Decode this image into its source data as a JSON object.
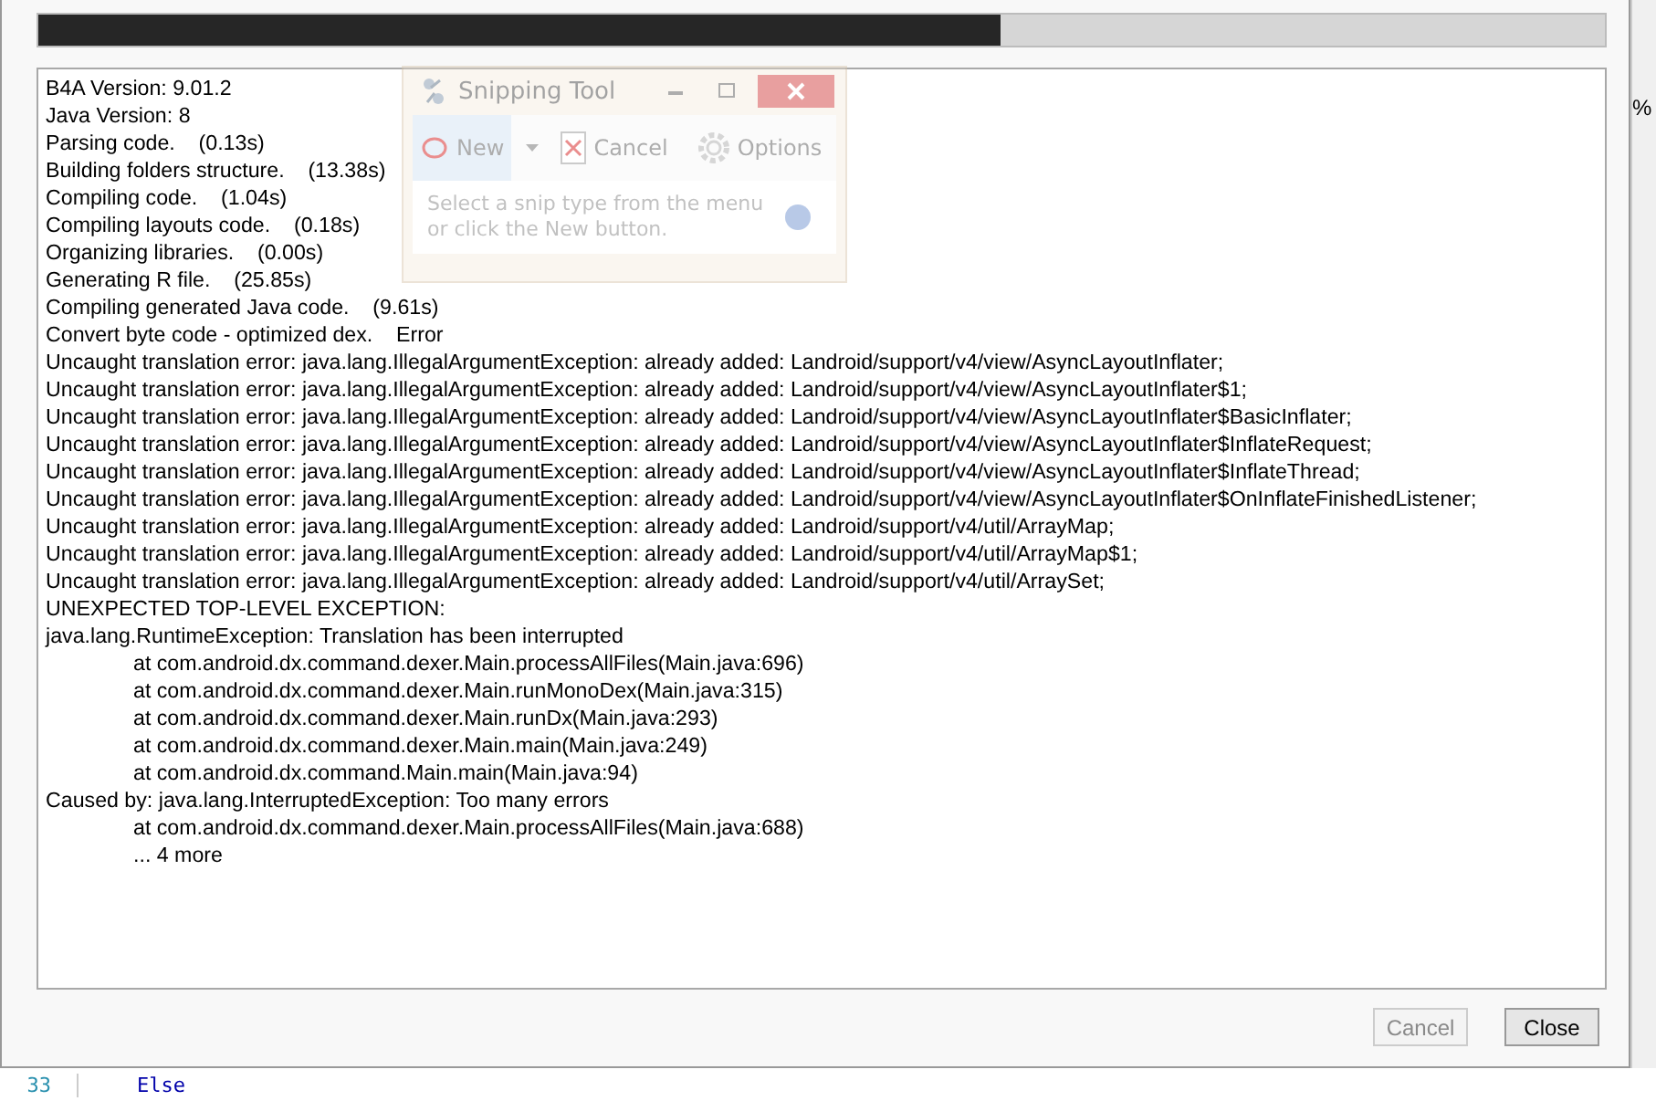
{
  "progress": {
    "level": 0.614
  },
  "log": [
    {
      "kind": "plain",
      "text": "B4A Version: 9.01.2"
    },
    {
      "kind": "plain",
      "text": "Java Version: 8"
    },
    {
      "kind": "plain",
      "text": "Parsing code.    (0.13s)"
    },
    {
      "kind": "plain",
      "text": "Building folders structure.    (13.38s)"
    },
    {
      "kind": "plain",
      "text": "Compiling code.    (1.04s)"
    },
    {
      "kind": "plain",
      "text": "Compiling layouts code.    (0.18s)"
    },
    {
      "kind": "plain",
      "text": "Organizing libraries.    (0.00s)"
    },
    {
      "kind": "plain",
      "text": "Generating R file.    (25.85s)"
    },
    {
      "kind": "plain",
      "text": "Compiling generated Java code.    (9.61s)"
    },
    {
      "kind": "plain",
      "text": "Convert byte code - optimized dex.    Error"
    },
    {
      "kind": "plain",
      "text": "Uncaught translation error: java.lang.IllegalArgumentException: already added: Landroid/support/v4/view/AsyncLayoutInflater;"
    },
    {
      "kind": "plain",
      "text": "Uncaught translation error: java.lang.IllegalArgumentException: already added: Landroid/support/v4/view/AsyncLayoutInflater$1;"
    },
    {
      "kind": "plain",
      "text": "Uncaught translation error: java.lang.IllegalArgumentException: already added: Landroid/support/v4/view/AsyncLayoutInflater$BasicInflater;"
    },
    {
      "kind": "plain",
      "text": "Uncaught translation error: java.lang.IllegalArgumentException: already added: Landroid/support/v4/view/AsyncLayoutInflater$InflateRequest;"
    },
    {
      "kind": "plain",
      "text": "Uncaught translation error: java.lang.IllegalArgumentException: already added: Landroid/support/v4/view/AsyncLayoutInflater$InflateThread;"
    },
    {
      "kind": "plain",
      "text": "Uncaught translation error: java.lang.IllegalArgumentException: already added: Landroid/support/v4/view/AsyncLayoutInflater$OnInflateFinishedListener;"
    },
    {
      "kind": "plain",
      "text": "Uncaught translation error: java.lang.IllegalArgumentException: already added: Landroid/support/v4/util/ArrayMap;"
    },
    {
      "kind": "plain",
      "text": "Uncaught translation error: java.lang.IllegalArgumentException: already added: Landroid/support/v4/util/ArrayMap$1;"
    },
    {
      "kind": "plain",
      "text": "Uncaught translation error: java.lang.IllegalArgumentException: already added: Landroid/support/v4/util/ArraySet;"
    },
    {
      "kind": "plain",
      "text": "UNEXPECTED TOP-LEVEL EXCEPTION:"
    },
    {
      "kind": "plain",
      "text": "java.lang.RuntimeException: Translation has been interrupted"
    },
    {
      "kind": "stack",
      "text": "at com.android.dx.command.dexer.Main.processAllFiles(Main.java:696)"
    },
    {
      "kind": "stack",
      "text": "at com.android.dx.command.dexer.Main.runMonoDex(Main.java:315)"
    },
    {
      "kind": "stack",
      "text": "at com.android.dx.command.dexer.Main.runDx(Main.java:293)"
    },
    {
      "kind": "stack",
      "text": "at com.android.dx.command.dexer.Main.main(Main.java:249)"
    },
    {
      "kind": "stack",
      "text": "at com.android.dx.command.Main.main(Main.java:94)"
    },
    {
      "kind": "plain",
      "text": "Caused by: java.lang.InterruptedException: Too many errors"
    },
    {
      "kind": "stack",
      "text": "at com.android.dx.command.dexer.Main.processAllFiles(Main.java:688)"
    },
    {
      "kind": "stack",
      "text": "... 4 more"
    }
  ],
  "buttons": [
    {
      "label": "Cancel",
      "disabled": true
    },
    {
      "label": "Close",
      "disabled": false
    }
  ],
  "snipping_tool": {
    "title": "Snipping Tool",
    "toolbar": [
      {
        "kind": "new",
        "label": "New"
      },
      {
        "kind": "cancel",
        "label": "Cancel"
      },
      {
        "kind": "options",
        "label": "Options"
      }
    ],
    "message": "Select a snip type from the menu or click the New button."
  },
  "editor": {
    "line_number": "33",
    "code": "Else",
    "side_text": "%"
  }
}
